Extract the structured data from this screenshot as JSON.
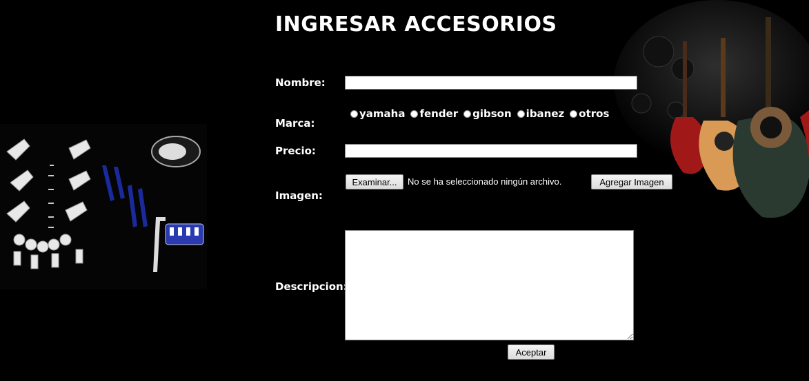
{
  "page": {
    "title": "INGRESAR ACCESORIOS"
  },
  "form": {
    "nombre": {
      "label": "Nombre:",
      "value": ""
    },
    "marca": {
      "label": "Marca:",
      "options": [
        "yamaha",
        "fender",
        "gibson",
        "ibanez",
        "otros"
      ],
      "selected": null
    },
    "precio": {
      "label": "Precio:",
      "value": ""
    },
    "imagen": {
      "label": "Imagen:",
      "browse_label": "Examinar...",
      "file_status": "No se ha seleccionado ningún archivo.",
      "add_label": "Agregar Imagen"
    },
    "descripcion": {
      "label": "Descripcion:",
      "value": ""
    },
    "submit_label": "Aceptar"
  },
  "colors": {
    "background": "#000000",
    "text": "#ffffff",
    "input_bg": "#ffffff"
  }
}
